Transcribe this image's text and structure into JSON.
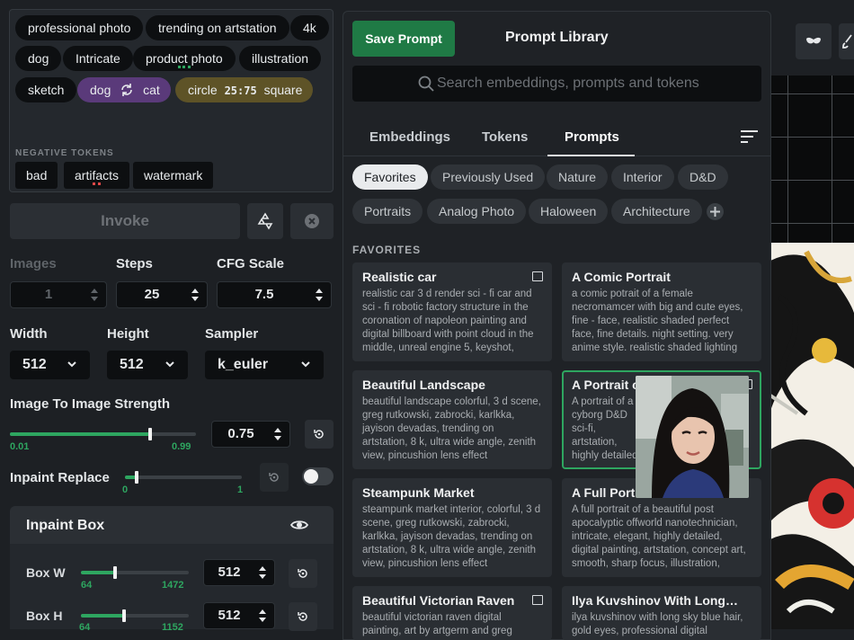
{
  "prompt_tokens": [
    {
      "label": "professional photo"
    },
    {
      "label": "trending on artstation"
    },
    {
      "label": "4k"
    },
    {
      "label": "dog"
    },
    {
      "label": "Intricate"
    },
    {
      "label": "product photo"
    },
    {
      "label": "illustration"
    },
    {
      "label": "sketch"
    }
  ],
  "swap_token": {
    "from": "dog",
    "to": "cat"
  },
  "blend_token": {
    "from": "circle",
    "ratio": "25:75",
    "to": "square"
  },
  "negative": {
    "heading": "NEGATIVE TOKENS",
    "tokens": [
      "bad",
      "artifacts",
      "watermark"
    ]
  },
  "invoke": {
    "label": "Invoke"
  },
  "params": {
    "images": {
      "label": "Images",
      "value": "1"
    },
    "steps": {
      "label": "Steps",
      "value": "25"
    },
    "cfg": {
      "label": "CFG Scale",
      "value": "7.5"
    },
    "width": {
      "label": "Width",
      "value": "512"
    },
    "height": {
      "label": "Height",
      "value": "512"
    },
    "sampler": {
      "label": "Sampler",
      "value": "k_euler"
    }
  },
  "img2img": {
    "label": "Image To Image Strength",
    "min": "0.01",
    "max": "0.99",
    "value": "0.75",
    "level": 0.75
  },
  "inpaint_replace": {
    "label": "Inpaint Replace",
    "min": "0",
    "max": "1",
    "level": 0.05,
    "toggle": false
  },
  "inpaint_box": {
    "title": "Inpaint Box",
    "w": {
      "label": "Box W",
      "min": "64",
      "max": "1472",
      "value": "512",
      "level": 0.32
    },
    "h": {
      "label": "Box H",
      "min": "64",
      "max": "1152",
      "value": "512",
      "level": 0.4
    }
  },
  "library": {
    "save_label": "Save Prompt",
    "title": "Prompt Library",
    "search_placeholder": "Search embeddings, prompts and tokens",
    "tabs": [
      "Embeddings",
      "Tokens",
      "Prompts"
    ],
    "active_tab": "Prompts",
    "filters": [
      "Favorites",
      "Previously Used",
      "Nature",
      "Interior",
      "D&D",
      "Portraits",
      "Analog Photo",
      "Haloween",
      "Architecture"
    ],
    "section": "FAVORITES",
    "cards": [
      {
        "title": "Realistic car",
        "desc": "realistic car 3 d render sci - fi car and sci - fi robotic factory structure in the coronation of napoleon painting and digital billboard with point cloud in the middle, unreal engine 5, keyshot,"
      },
      {
        "title": "A Comic Portrait",
        "desc": "a comic potrait of a female necromamcer with big and cute eyes, fine - face, realistic shaded perfect face, fine details. night setting. very anime style. realistic shaded lighting"
      },
      {
        "title": "Beautiful Landscape",
        "desc": "beautiful landscape colorful, 3 d scene, greg rutkowski, zabrocki, karlkka, jayison devadas, trending on artstation, 8 k, ultra wide angle, zenith view, pincushion lens effect"
      },
      {
        "title": "A Portrait of a Cyborg",
        "desc": "A portrait of a cyborg D&D sci-fi, artstation, highly detailed"
      },
      {
        "title": "Steampunk Market",
        "desc": "steampunk market interior, colorful, 3 d scene, greg rutkowski, zabrocki, karlkka, jayison devadas, trending on artstation, 8 k, ultra wide angle, zenith view, pincushion lens effect"
      },
      {
        "title": "A Full Portrait",
        "desc": "A full portrait of a beautiful post apocalyptic offworld nanotechnician, intricate, elegant, highly detailed, digital painting, artstation, concept art, smooth, sharp focus, illustration,"
      },
      {
        "title": "Beautiful Victorian Raven",
        "desc": "beautiful victorian raven digital painting, art by artgerm and greg"
      },
      {
        "title": "Ilya Kuvshinov With Long…",
        "desc": "ilya kuvshinov with long sky blue hair, gold eyes, professional digital"
      }
    ]
  },
  "colors": {
    "accent": "#2ea660",
    "save": "#1f7a45",
    "swap": "#5a3a7a",
    "blend": "#5e5327"
  }
}
